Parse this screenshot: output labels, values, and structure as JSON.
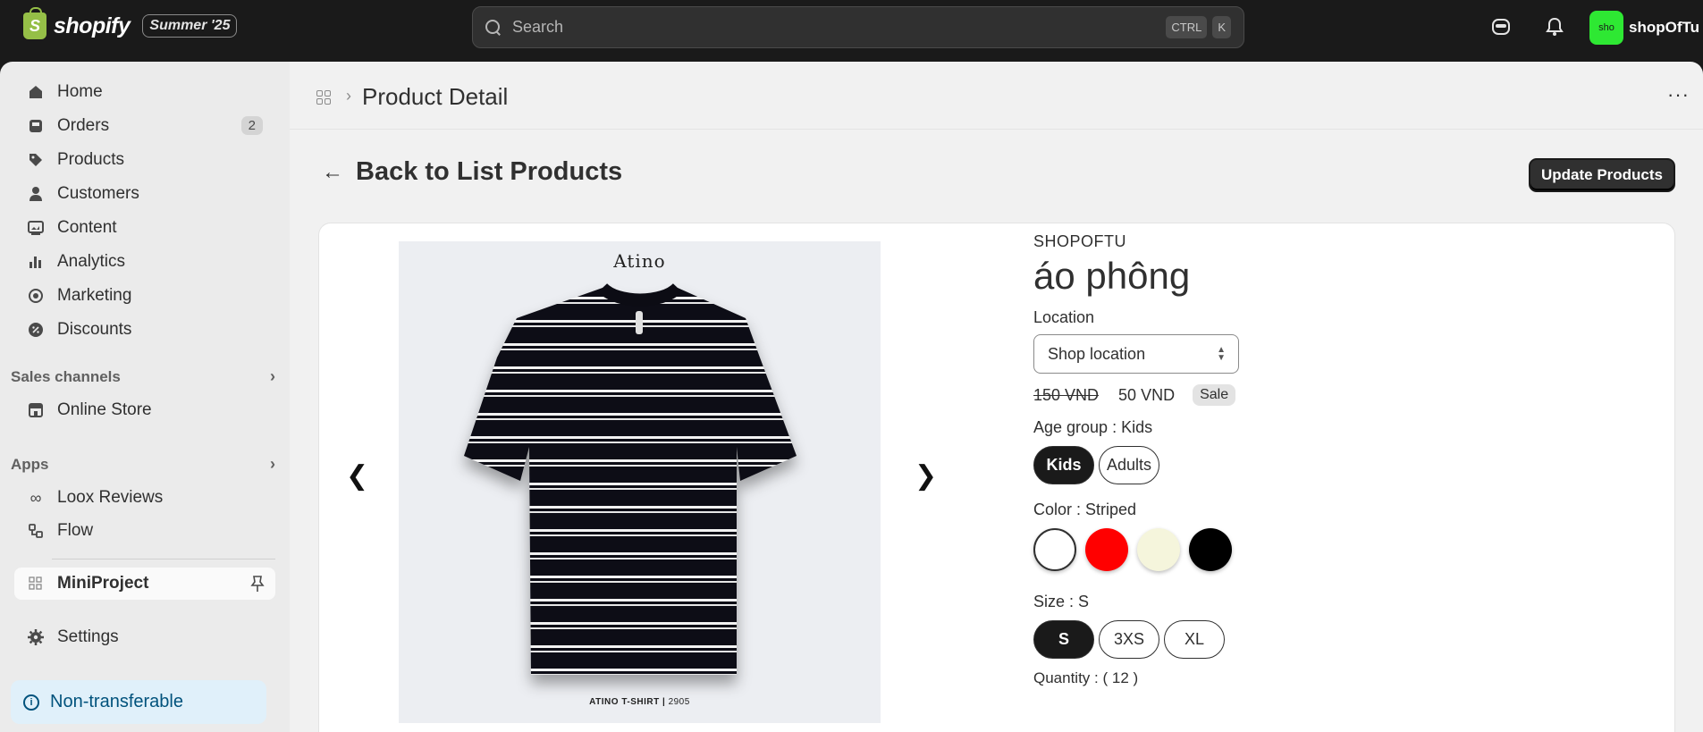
{
  "topbar": {
    "brand": "shopify",
    "logo_letter": "S",
    "edition_badge": "Summer '25",
    "search_placeholder": "Search",
    "shortcut_keys": [
      "CTRL",
      "K"
    ],
    "store_avatar_text": "sho",
    "store_name": "shopOfTu",
    "avatar_color": "#2ee833"
  },
  "sidebar": {
    "items": [
      {
        "label": "Home",
        "icon": "home-icon"
      },
      {
        "label": "Orders",
        "icon": "inbox-icon",
        "count": "2"
      },
      {
        "label": "Products",
        "icon": "tag-icon"
      },
      {
        "label": "Customers",
        "icon": "person-icon"
      },
      {
        "label": "Content",
        "icon": "image-icon"
      },
      {
        "label": "Analytics",
        "icon": "bar-chart-icon"
      },
      {
        "label": "Marketing",
        "icon": "target-icon"
      },
      {
        "label": "Discounts",
        "icon": "discount-icon"
      }
    ],
    "sales_channels_label": "Sales channels",
    "online_store_label": "Online Store",
    "apps_label": "Apps",
    "apps": [
      {
        "label": "Loox Reviews",
        "icon": "infinity-icon"
      },
      {
        "label": "Flow",
        "icon": "flow-icon"
      }
    ],
    "pinned_app": "MiniProject",
    "settings_label": "Settings",
    "notice": "Non-transferable"
  },
  "main": {
    "breadcrumb_sep": "›",
    "page_title": "Product Detail",
    "more_glyph": "···",
    "back_label": "Back to List Products",
    "update_button": "Update Products"
  },
  "product": {
    "image": {
      "brand_top": "Atino",
      "caption": "ATINO T-SHIRT |",
      "caption_num": "2905"
    },
    "vendor": "SHOPOFTU",
    "name": "áo phông",
    "location_label": "Location",
    "location_value": "Shop location",
    "old_price": "150 VND",
    "price": "50 VND",
    "sale_badge": "Sale",
    "age_label": "Age group : Kids",
    "age_options": [
      "Kids",
      "Adults"
    ],
    "age_selected": 0,
    "color_label": "Color : Striped",
    "colors": [
      "#ffffff",
      "#ff0000",
      "#f5f5dc",
      "#000000"
    ],
    "color_selected": 0,
    "size_label": "Size : S",
    "size_options": [
      "S",
      "3XS",
      "XL"
    ],
    "size_selected": 0,
    "quantity": "Quantity : ( 12 )"
  }
}
